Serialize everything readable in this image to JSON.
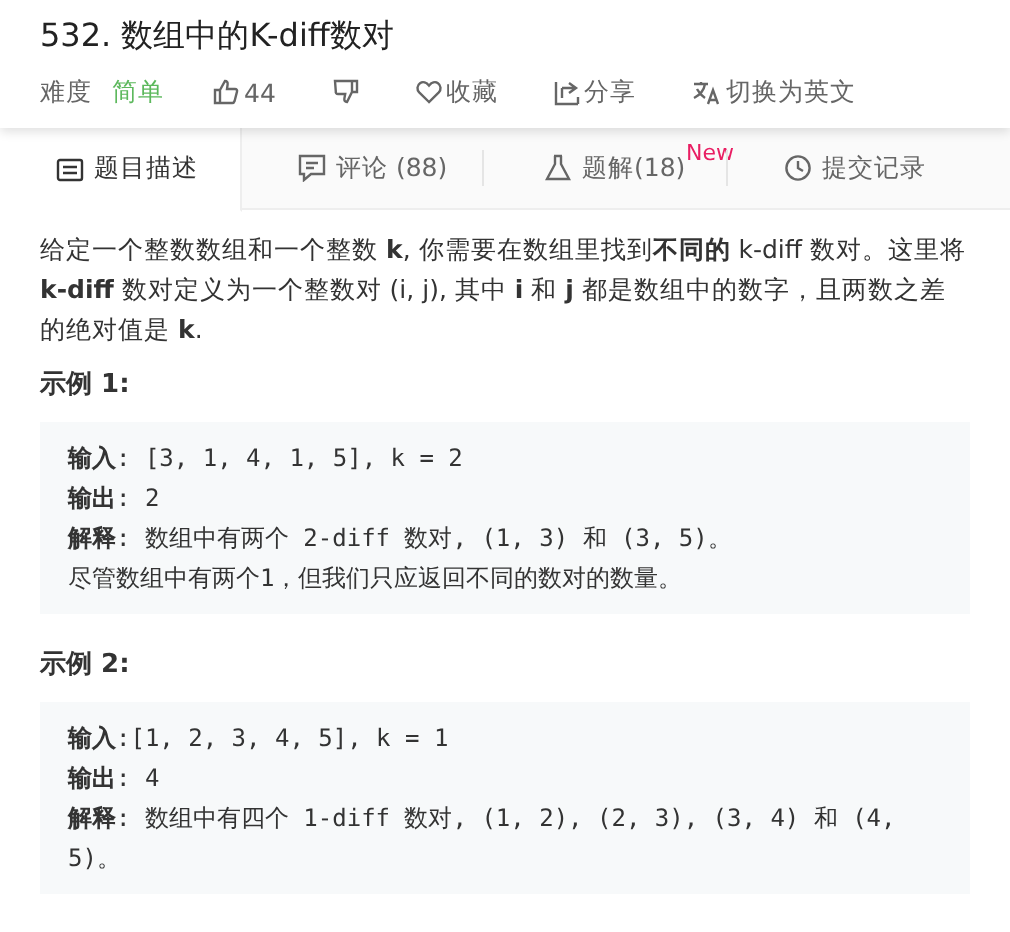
{
  "title": "532. 数组中的K-diff数对",
  "meta": {
    "difficulty_label": "难度",
    "difficulty": "简单",
    "likes": "44",
    "actions": [
      {
        "kind": "dislike"
      },
      {
        "kind": "favorite",
        "label": "收藏"
      },
      {
        "kind": "share",
        "label": "分享"
      },
      {
        "kind": "translate",
        "label": "切换为英文"
      }
    ]
  },
  "tabs": [
    {
      "kind": "description",
      "label": "题目描述",
      "selected": true
    },
    {
      "kind": "comments",
      "label": "评论 (88)",
      "selected": false
    },
    {
      "kind": "solutions",
      "label": "题解(18)",
      "badge": "New",
      "selected": false
    },
    {
      "kind": "submissions",
      "label": "提交记录",
      "selected": false
    }
  ],
  "description": "给定一个整数数组和一个整数 **k**, 你需要在数组里找到**不同的** k-diff 数对。这里将 **k-diff** 数对定义为一个整数对 (i, j), 其中 **i** 和 **j** 都是数组中的数字，且两数之差的绝对值是 **k**.",
  "examples": [
    {
      "heading": "示例 1:",
      "lines": [
        "**输入**: [3, 1, 4, 1, 5], k = 2",
        "**输出**: 2",
        "**解释**: 数组中有两个 2-diff 数对, (1, 3) 和 (3, 5)。",
        "尽管数组中有两个1，但我们只应返回不同的数对的数量。"
      ]
    },
    {
      "heading": "示例 2:",
      "lines": [
        "**输入**:[1, 2, 3, 4, 5], k = 1",
        "**输出**: 4",
        "**解释**: 数组中有四个 1-diff 数对, (1, 2), (2, 3), (3, 4) 和 (4, 5)。"
      ]
    }
  ]
}
